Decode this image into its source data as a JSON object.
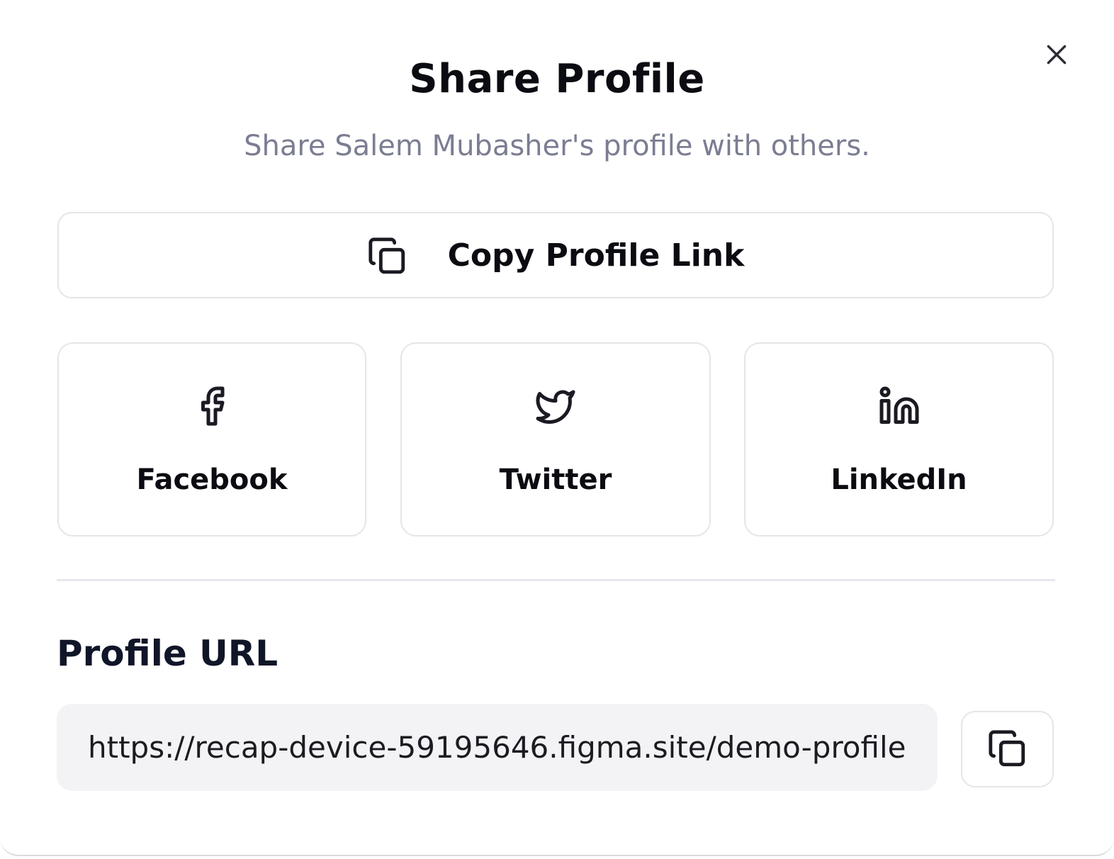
{
  "dialog": {
    "title": "Share Profile",
    "subtitle": "Share Salem Mubasher's profile with others.",
    "close_icon": "close-icon"
  },
  "copy_link": {
    "label": "Copy Profile Link",
    "icon": "copy-icon"
  },
  "social": [
    {
      "label": "Facebook",
      "icon": "facebook-icon"
    },
    {
      "label": "Twitter",
      "icon": "twitter-icon"
    },
    {
      "label": "LinkedIn",
      "icon": "linkedin-icon"
    }
  ],
  "profile_url": {
    "heading": "Profile URL",
    "value": "https://recap-device-59195646.figma.site/demo-profile",
    "copy_icon": "copy-icon"
  },
  "colors": {
    "text": "#0b0b12",
    "subtitle": "#7b7d92",
    "border": "#e5e5ea",
    "field_bg": "#f3f3f5"
  }
}
